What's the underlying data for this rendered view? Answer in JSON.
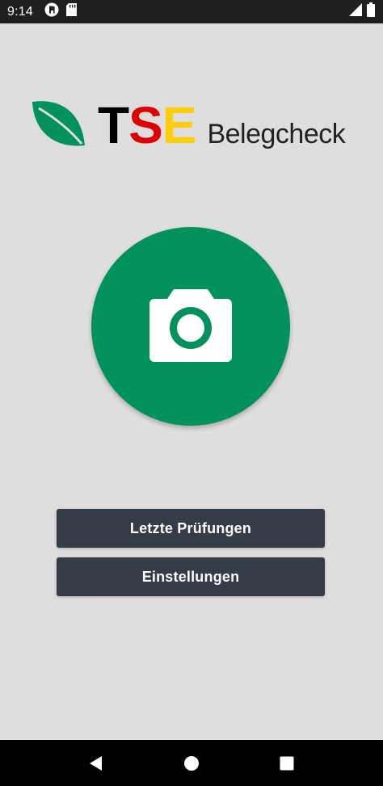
{
  "status_bar": {
    "time": "9:14",
    "icons_left": [
      "notification-app-icon",
      "sd-card-icon"
    ],
    "icons_right": [
      "signal-icon",
      "battery-icon"
    ]
  },
  "logo": {
    "letters": [
      "T",
      "S",
      "E"
    ],
    "letter_colors": [
      "#000000",
      "#dd0000",
      "#ffce00"
    ],
    "subtitle": "Belegcheck",
    "leaf_color": "#01915c"
  },
  "camera": {
    "icon": "camera-icon",
    "color": "#01915c"
  },
  "buttons": {
    "recent_checks": "Letzte Prüfungen",
    "settings": "Einstellungen"
  },
  "nav_bar": {
    "icons": [
      "back-icon",
      "home-icon",
      "recents-icon"
    ]
  }
}
